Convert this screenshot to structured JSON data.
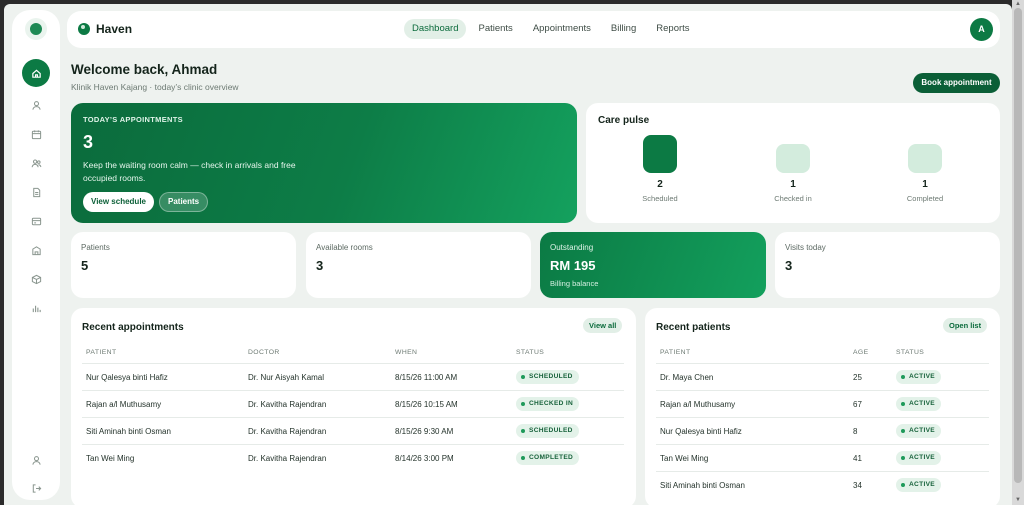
{
  "app": {
    "brand": "Haven",
    "avatar_initial": "A"
  },
  "nav": [
    {
      "label": "Dashboard",
      "active": true
    },
    {
      "label": "Patients",
      "active": false
    },
    {
      "label": "Appointments",
      "active": false
    },
    {
      "label": "Billing",
      "active": false
    },
    {
      "label": "Reports",
      "active": false
    }
  ],
  "sidebar_icons": [
    "home-icon",
    "user-icon",
    "calendar-icon",
    "users-icon",
    "document-icon",
    "card-icon",
    "building-icon",
    "box-icon",
    "bar-chart-icon",
    "profile-icon",
    "logout-icon"
  ],
  "header": {
    "title": "Welcome back, Ahmad",
    "subtitle": "Klinik Haven Kajang · today’s clinic overview",
    "book_label": "Book appointment"
  },
  "hero": {
    "label": "TODAY’S APPOINTMENTS",
    "value": "3",
    "text": "Keep the waiting room calm — check in arrivals and free occupied rooms.",
    "btn_schedule": "View schedule",
    "btn_patients": "Patients"
  },
  "pulse": {
    "title": "Care pulse",
    "items": [
      {
        "value": "2",
        "label": "Scheduled",
        "level": 2
      },
      {
        "value": "1",
        "label": "Checked in",
        "level": 1
      },
      {
        "value": "1",
        "label": "Completed",
        "level": 1
      }
    ]
  },
  "stats": [
    {
      "label": "Patients",
      "value": "5"
    },
    {
      "label": "Available rooms",
      "value": "3"
    },
    {
      "label": "Outstanding",
      "value": "RM 195",
      "sub": "Billing balance"
    },
    {
      "label": "Visits today",
      "value": "3"
    }
  ],
  "appointments": {
    "title": "Recent appointments",
    "action": "View all",
    "headers": [
      "PATIENT",
      "DOCTOR",
      "WHEN",
      "STATUS"
    ],
    "rows": [
      [
        "Nur Qalesya binti Hafiz",
        "Dr. Nur Aisyah Kamal",
        "8/15/26 11:00 AM",
        "SCHEDULED"
      ],
      [
        "Rajan a/l Muthusamy",
        "Dr. Kavitha Rajendran",
        "8/15/26 10:15 AM",
        "CHECKED IN"
      ],
      [
        "Siti Aminah binti Osman",
        "Dr. Kavitha Rajendran",
        "8/15/26 9:30 AM",
        "SCHEDULED"
      ],
      [
        "Tan Wei Ming",
        "Dr. Kavitha Rajendran",
        "8/14/26 3:00 PM",
        "COMPLETED"
      ]
    ]
  },
  "patients": {
    "title": "Recent patients",
    "action": "Open list",
    "headers": [
      "PATIENT",
      "AGE",
      "STATUS"
    ],
    "rows": [
      [
        "Dr. Maya Chen",
        "25",
        "ACTIVE"
      ],
      [
        "Rajan a/l Muthusamy",
        "67",
        "ACTIVE"
      ],
      [
        "Nur Qalesya binti Hafiz",
        "8",
        "ACTIVE"
      ],
      [
        "Tan Wei Ming",
        "41",
        "ACTIVE"
      ],
      [
        "Siti Aminah binti Osman",
        "34",
        "ACTIVE"
      ]
    ]
  },
  "colors": {
    "brand": "#0c7a44",
    "accent_light": "#e2efe7"
  }
}
